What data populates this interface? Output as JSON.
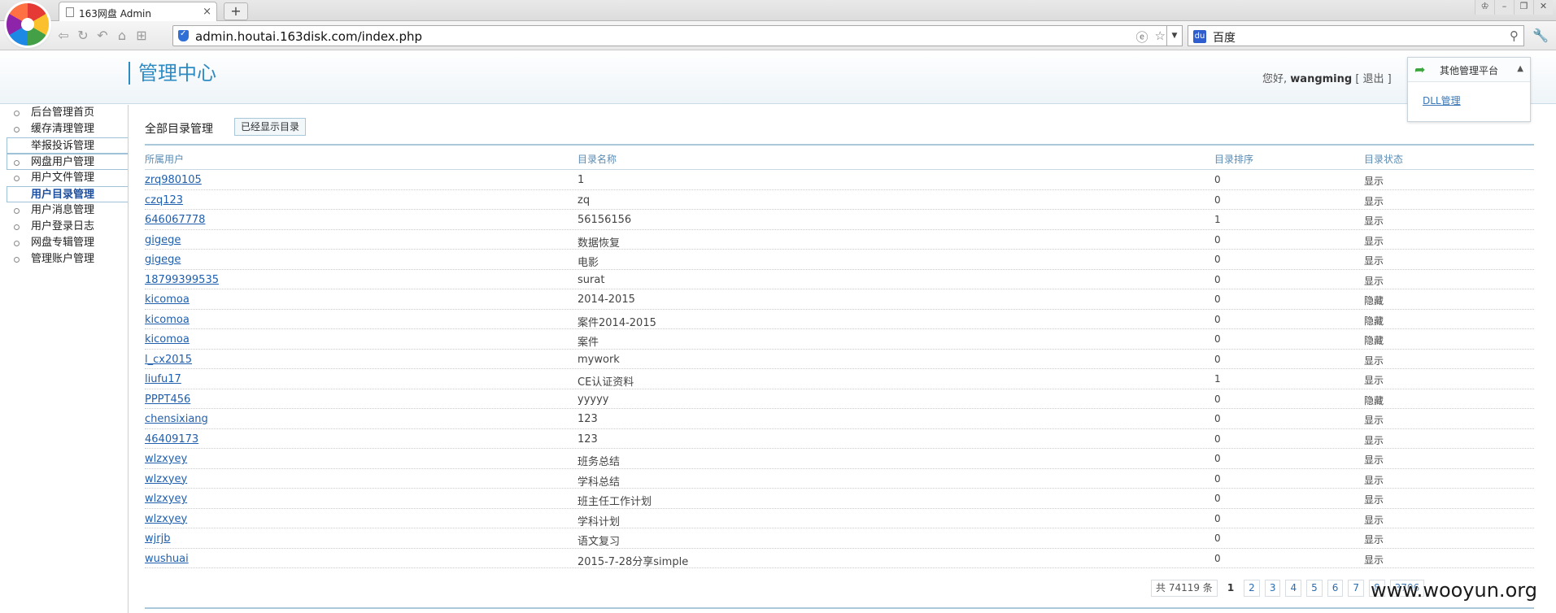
{
  "browser": {
    "tab_title": "163网盘 Admin",
    "tab_close": "×",
    "new_tab": "+",
    "url": "admin.houtai.163disk.com/index.php",
    "search_engine": "百度",
    "search_engine_badge": "du",
    "window_controls": [
      "♔",
      "–",
      "❐",
      "✕"
    ]
  },
  "header": {
    "title": "管理中心",
    "greeting_prefix": "您好,",
    "username": "wangming",
    "logout_label": "[ 退出 ]",
    "platform_menu": {
      "label": "其他管理平台",
      "items": [
        "DLL管理"
      ]
    }
  },
  "sidebar": {
    "items": [
      {
        "label": "后台管理首页"
      },
      {
        "label": "缓存清理管理"
      },
      {
        "label": "举报投诉管理"
      },
      {
        "label": "网盘用户管理"
      },
      {
        "label": "用户文件管理"
      },
      {
        "label": "用户目录管理"
      },
      {
        "label": "用户消息管理"
      },
      {
        "label": "用户登录日志"
      },
      {
        "label": "网盘专辑管理"
      },
      {
        "label": "管理账户管理"
      }
    ]
  },
  "main": {
    "section_title": "全部目录管理",
    "shown_button": "已经显示目录",
    "columns": [
      "所属用户",
      "目录名称",
      "目录排序",
      "目录状态"
    ],
    "rows": [
      {
        "user": "zrq980105",
        "name": "1",
        "order": "0",
        "status": "显示"
      },
      {
        "user": "czq123",
        "name": "zq",
        "order": "0",
        "status": "显示"
      },
      {
        "user": "646067778",
        "name": "56156156",
        "order": "1",
        "status": "显示"
      },
      {
        "user": "gigege",
        "name": "数据恢复",
        "order": "0",
        "status": "显示"
      },
      {
        "user": "gigege",
        "name": "电影",
        "order": "0",
        "status": "显示"
      },
      {
        "user": "18799399535",
        "name": "surat",
        "order": "0",
        "status": "显示"
      },
      {
        "user": "kicomoa",
        "name": "2014-2015",
        "order": "0",
        "status": "隐藏"
      },
      {
        "user": "kicomoa",
        "name": "案件2014-2015",
        "order": "0",
        "status": "隐藏"
      },
      {
        "user": "kicomoa",
        "name": "案件",
        "order": "0",
        "status": "隐藏"
      },
      {
        "user": "l_cx2015",
        "name": "mywork",
        "order": "0",
        "status": "显示"
      },
      {
        "user": "liufu17",
        "name": "CE认证资料",
        "order": "1",
        "status": "显示"
      },
      {
        "user": "PPPT456",
        "name": "yyyyy",
        "order": "0",
        "status": "隐藏"
      },
      {
        "user": "chensixiang",
        "name": "123",
        "order": "0",
        "status": "显示"
      },
      {
        "user": "46409173",
        "name": "123",
        "order": "0",
        "status": "显示"
      },
      {
        "user": "wlzxyey",
        "name": "班务总结",
        "order": "0",
        "status": "显示"
      },
      {
        "user": "wlzxyey",
        "name": "学科总结",
        "order": "0",
        "status": "显示"
      },
      {
        "user": "wlzxyey",
        "name": "班主任工作计划",
        "order": "0",
        "status": "显示"
      },
      {
        "user": "wlzxyey",
        "name": "学科计划",
        "order": "0",
        "status": "显示"
      },
      {
        "user": "wjrjb",
        "name": "语文复习",
        "order": "0",
        "status": "显示"
      },
      {
        "user": "wushuai",
        "name": "2015-7-28分享simple",
        "order": "0",
        "status": "显示"
      }
    ]
  },
  "pager": {
    "total": "共 74119 条",
    "current": "1",
    "pages": [
      "2",
      "3",
      "4",
      "5",
      "6",
      "7",
      "8",
      "3706"
    ]
  },
  "watermark": "www.wooyun.org"
}
